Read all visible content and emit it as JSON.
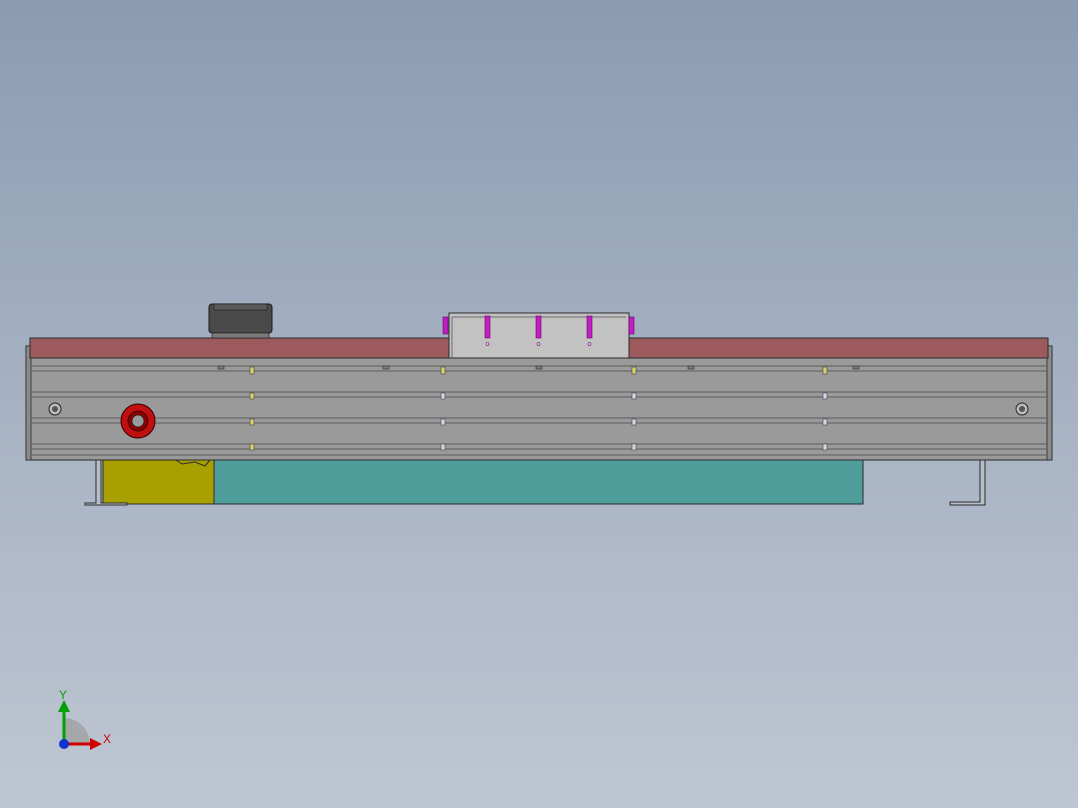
{
  "viewport": {
    "background_top": "#8a9bb1",
    "background_bottom": "#bfc6d3"
  },
  "model": {
    "description_colors": {
      "top_rail": "#9c5a5c",
      "frame": "#9a9a9a",
      "frame_groove": "#6f6f6f",
      "center_carriage": "#c2c2c2",
      "motor_block": "#4a4a4a",
      "yellow_cover": "#a8a000",
      "teal_base": "#4f9e9b",
      "red_knob": "#c01010",
      "magenta_bolts": "#c020c0",
      "slot_yellow": "#d8d06a",
      "slot_blue": "#d0d8e8"
    }
  },
  "triad": {
    "x_label": "X",
    "y_label": "Y",
    "x_color": "#d00000",
    "y_color": "#00a000",
    "z_color": "#1030d0"
  }
}
